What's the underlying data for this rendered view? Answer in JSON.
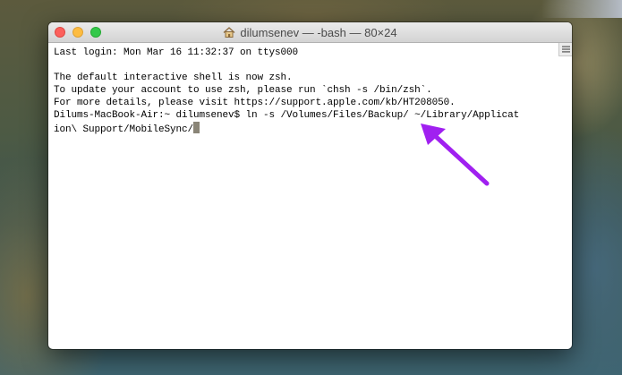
{
  "window": {
    "title": "dilumsenev — -bash — 80×24",
    "title_icon": "home-icon"
  },
  "terminal": {
    "lines": [
      "Last login: Mon Mar 16 11:32:37 on ttys000",
      "",
      "The default interactive shell is now zsh.",
      "To update your account to use zsh, please run `chsh -s /bin/zsh`.",
      "For more details, please visit https://support.apple.com/kb/HT208050.",
      "Dilums-MacBook-Air:~ dilumsenev$ ln -s /Volumes/Files/Backup/ ~/Library/Applicat",
      "ion\\ Support/MobileSync/"
    ]
  },
  "annotation": {
    "icon": "arrow-icon",
    "color": "#a020f0"
  },
  "colors": {
    "close": "#fc605c",
    "minimize": "#fdbc40",
    "maximize": "#34c84a",
    "cursor": "#8a8577"
  }
}
